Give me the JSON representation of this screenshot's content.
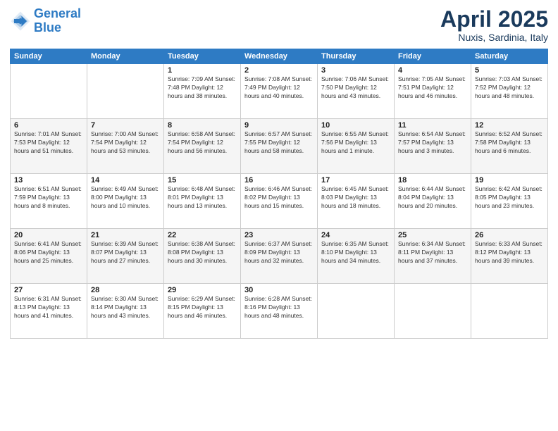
{
  "logo": {
    "line1": "General",
    "line2": "Blue"
  },
  "title": "April 2025",
  "location": "Nuxis, Sardinia, Italy",
  "weekdays": [
    "Sunday",
    "Monday",
    "Tuesday",
    "Wednesday",
    "Thursday",
    "Friday",
    "Saturday"
  ],
  "weeks": [
    [
      {
        "day": "",
        "info": ""
      },
      {
        "day": "",
        "info": ""
      },
      {
        "day": "1",
        "info": "Sunrise: 7:09 AM\nSunset: 7:48 PM\nDaylight: 12 hours and 38 minutes."
      },
      {
        "day": "2",
        "info": "Sunrise: 7:08 AM\nSunset: 7:49 PM\nDaylight: 12 hours and 40 minutes."
      },
      {
        "day": "3",
        "info": "Sunrise: 7:06 AM\nSunset: 7:50 PM\nDaylight: 12 hours and 43 minutes."
      },
      {
        "day": "4",
        "info": "Sunrise: 7:05 AM\nSunset: 7:51 PM\nDaylight: 12 hours and 46 minutes."
      },
      {
        "day": "5",
        "info": "Sunrise: 7:03 AM\nSunset: 7:52 PM\nDaylight: 12 hours and 48 minutes."
      }
    ],
    [
      {
        "day": "6",
        "info": "Sunrise: 7:01 AM\nSunset: 7:53 PM\nDaylight: 12 hours and 51 minutes."
      },
      {
        "day": "7",
        "info": "Sunrise: 7:00 AM\nSunset: 7:54 PM\nDaylight: 12 hours and 53 minutes."
      },
      {
        "day": "8",
        "info": "Sunrise: 6:58 AM\nSunset: 7:54 PM\nDaylight: 12 hours and 56 minutes."
      },
      {
        "day": "9",
        "info": "Sunrise: 6:57 AM\nSunset: 7:55 PM\nDaylight: 12 hours and 58 minutes."
      },
      {
        "day": "10",
        "info": "Sunrise: 6:55 AM\nSunset: 7:56 PM\nDaylight: 13 hours and 1 minute."
      },
      {
        "day": "11",
        "info": "Sunrise: 6:54 AM\nSunset: 7:57 PM\nDaylight: 13 hours and 3 minutes."
      },
      {
        "day": "12",
        "info": "Sunrise: 6:52 AM\nSunset: 7:58 PM\nDaylight: 13 hours and 6 minutes."
      }
    ],
    [
      {
        "day": "13",
        "info": "Sunrise: 6:51 AM\nSunset: 7:59 PM\nDaylight: 13 hours and 8 minutes."
      },
      {
        "day": "14",
        "info": "Sunrise: 6:49 AM\nSunset: 8:00 PM\nDaylight: 13 hours and 10 minutes."
      },
      {
        "day": "15",
        "info": "Sunrise: 6:48 AM\nSunset: 8:01 PM\nDaylight: 13 hours and 13 minutes."
      },
      {
        "day": "16",
        "info": "Sunrise: 6:46 AM\nSunset: 8:02 PM\nDaylight: 13 hours and 15 minutes."
      },
      {
        "day": "17",
        "info": "Sunrise: 6:45 AM\nSunset: 8:03 PM\nDaylight: 13 hours and 18 minutes."
      },
      {
        "day": "18",
        "info": "Sunrise: 6:44 AM\nSunset: 8:04 PM\nDaylight: 13 hours and 20 minutes."
      },
      {
        "day": "19",
        "info": "Sunrise: 6:42 AM\nSunset: 8:05 PM\nDaylight: 13 hours and 23 minutes."
      }
    ],
    [
      {
        "day": "20",
        "info": "Sunrise: 6:41 AM\nSunset: 8:06 PM\nDaylight: 13 hours and 25 minutes."
      },
      {
        "day": "21",
        "info": "Sunrise: 6:39 AM\nSunset: 8:07 PM\nDaylight: 13 hours and 27 minutes."
      },
      {
        "day": "22",
        "info": "Sunrise: 6:38 AM\nSunset: 8:08 PM\nDaylight: 13 hours and 30 minutes."
      },
      {
        "day": "23",
        "info": "Sunrise: 6:37 AM\nSunset: 8:09 PM\nDaylight: 13 hours and 32 minutes."
      },
      {
        "day": "24",
        "info": "Sunrise: 6:35 AM\nSunset: 8:10 PM\nDaylight: 13 hours and 34 minutes."
      },
      {
        "day": "25",
        "info": "Sunrise: 6:34 AM\nSunset: 8:11 PM\nDaylight: 13 hours and 37 minutes."
      },
      {
        "day": "26",
        "info": "Sunrise: 6:33 AM\nSunset: 8:12 PM\nDaylight: 13 hours and 39 minutes."
      }
    ],
    [
      {
        "day": "27",
        "info": "Sunrise: 6:31 AM\nSunset: 8:13 PM\nDaylight: 13 hours and 41 minutes."
      },
      {
        "day": "28",
        "info": "Sunrise: 6:30 AM\nSunset: 8:14 PM\nDaylight: 13 hours and 43 minutes."
      },
      {
        "day": "29",
        "info": "Sunrise: 6:29 AM\nSunset: 8:15 PM\nDaylight: 13 hours and 46 minutes."
      },
      {
        "day": "30",
        "info": "Sunrise: 6:28 AM\nSunset: 8:16 PM\nDaylight: 13 hours and 48 minutes."
      },
      {
        "day": "",
        "info": ""
      },
      {
        "day": "",
        "info": ""
      },
      {
        "day": "",
        "info": ""
      }
    ]
  ]
}
